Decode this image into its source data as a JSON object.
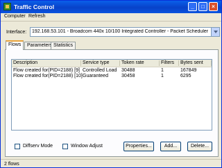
{
  "window": {
    "title": "Traffic Control"
  },
  "menu": [
    "Computer",
    "Refresh"
  ],
  "interface": {
    "label": "Interface:",
    "value": "192.168.53.101 - Broadcom 440x 10/100 Integrated Controller - Packet Scheduler Miniport"
  },
  "tabs": [
    "Flows",
    "Parameters",
    "Statistics"
  ],
  "flows": {
    "columns": [
      "Description",
      "Service type",
      "Token rate",
      "Filters",
      "Bytes sent"
    ],
    "rows": [
      [
        "Flow created for(PID=2188) [9]",
        "Controlled Load",
        "30488",
        "1",
        "167849"
      ],
      [
        "Flow created for(PID=2188) [10]",
        "Guaranteed",
        "30458",
        "1",
        "6295"
      ]
    ]
  },
  "options": {
    "diffserv": "Diffserv Mode",
    "window_adjust": "Window Adjust"
  },
  "buttons": {
    "properties": "Properties...",
    "add": "Add...",
    "delete": "Delete..."
  },
  "status": "2 flows"
}
